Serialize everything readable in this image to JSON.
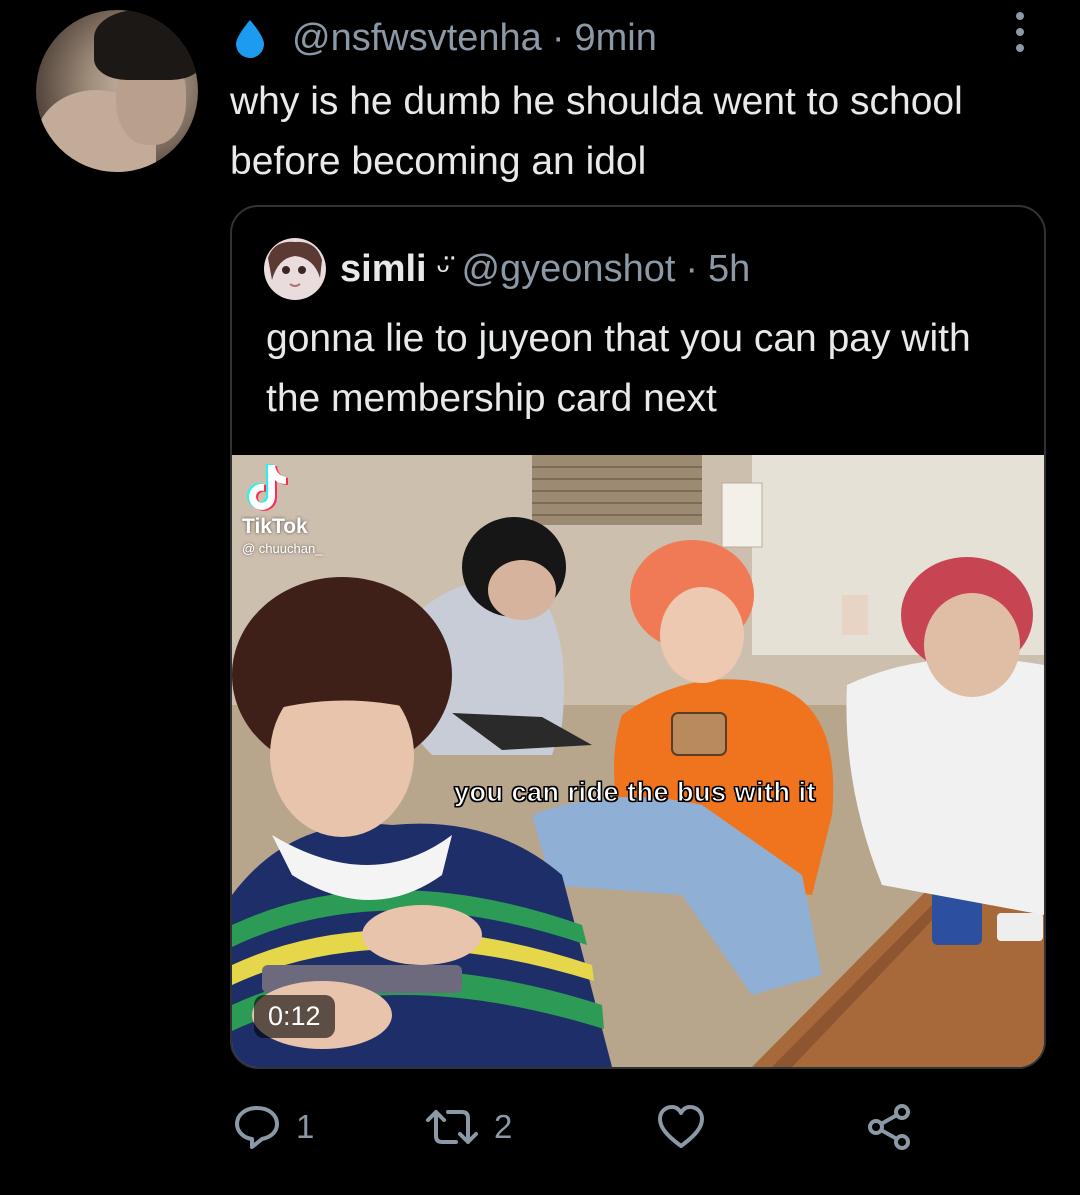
{
  "tweet": {
    "handle": "@nsfwsvtenha",
    "separator": "·",
    "time": "9min",
    "text": "why is he dumb he shoulda went to school before becoming an idol",
    "header_icon": "water-drop-icon",
    "accent_color": "#1d9bf0"
  },
  "quote": {
    "name": "simli",
    "name_emoji": "ᵕ̈",
    "handle": "@gyeonshot",
    "separator": "·",
    "time": "5h",
    "text": "gonna lie to juyeon that you can pay with the membership card next"
  },
  "media": {
    "watermark_label": "TikTok",
    "watermark_user": "@ chuuchan_",
    "caption": "you can ride the bus with it",
    "duration": "0:12"
  },
  "actions": {
    "reply_count": "1",
    "retweet_count": "2",
    "like_count": "",
    "icons": [
      "reply-icon",
      "retweet-icon",
      "like-icon",
      "share-icon"
    ]
  },
  "colors": {
    "background": "#000000",
    "text_primary": "#e7e9ea",
    "text_secondary": "#8b98a5",
    "border": "#2f3336"
  }
}
